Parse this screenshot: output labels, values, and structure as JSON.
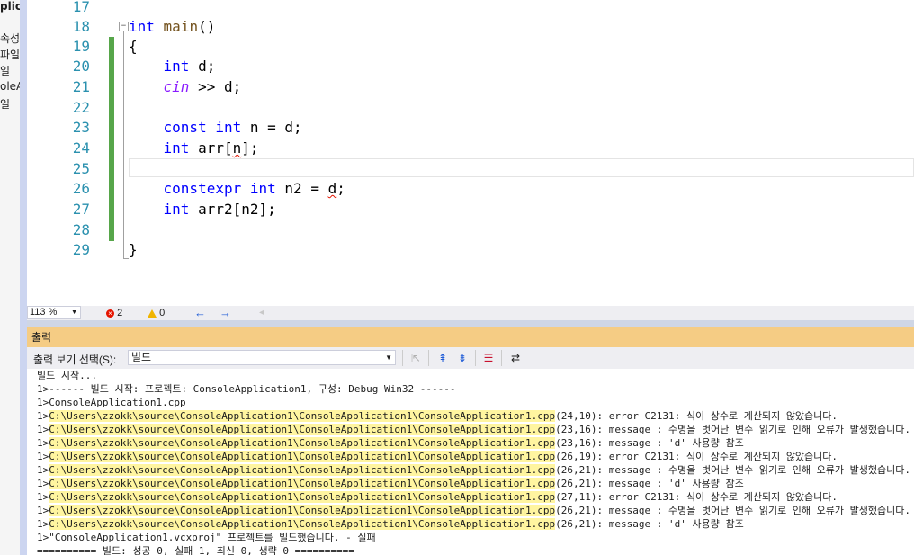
{
  "left_panel": {
    "items": [
      "plica",
      "속성",
      "파일",
      "일",
      "oleA",
      "일"
    ]
  },
  "editor": {
    "line_numbers": [
      "17",
      "18",
      "19",
      "20",
      "21",
      "22",
      "23",
      "24",
      "25",
      "26",
      "27",
      "28",
      "29"
    ],
    "outline_toggle": "−",
    "code": {
      "l18_kw": "int",
      "l18_fn": "main",
      "l18_rest": "()",
      "l19": "{",
      "l20_kw": "int",
      "l20_rest": " d;",
      "l21_it": "cin",
      "l21_rest": " >> d;",
      "l23_kw1": "const",
      "l23_kw2": "int",
      "l23_rest": " n = d;",
      "l24_kw": "int",
      "l24_pre": " arr[",
      "l24_sq": "n",
      "l24_post": "];",
      "l26_kw1": "constexpr",
      "l26_kw2": "int",
      "l26_pre": " n2 = ",
      "l26_sq": "d",
      "l26_post": ";",
      "l27_kw": "int",
      "l27_rest": " arr2[n2];",
      "l29": "}"
    }
  },
  "status_bar": {
    "zoom": "113 %",
    "errors": "2",
    "warnings": "0",
    "nav_back": "←",
    "nav_forward": "→",
    "nav_disabled": "◂"
  },
  "output": {
    "title": "출력",
    "source_label": "출력 보기 선택(S):",
    "source_value": "빌드",
    "lines": [
      {
        "pre": "빌드 시작...",
        "path": "",
        "post": ""
      },
      {
        "pre": "1>------ 빌드 시작: 프로젝트: ConsoleApplication1, 구성: Debug Win32 ------",
        "path": "",
        "post": ""
      },
      {
        "pre": "1>ConsoleApplication1.cpp",
        "path": "",
        "post": ""
      },
      {
        "pre": "1>",
        "path": "C:\\Users\\zzokk\\source\\ConsoleApplication1\\ConsoleApplication1\\ConsoleApplication1.cpp",
        "post": "(24,10): error C2131: 식이 상수로 계산되지 않았습니다."
      },
      {
        "pre": "1>",
        "path": "C:\\Users\\zzokk\\source\\ConsoleApplication1\\ConsoleApplication1\\ConsoleApplication1.cpp",
        "post": "(23,16): message : 수명을 벗어난 변수 읽기로 인해 오류가 발생했습니다."
      },
      {
        "pre": "1>",
        "path": "C:\\Users\\zzokk\\source\\ConsoleApplication1\\ConsoleApplication1\\ConsoleApplication1.cpp",
        "post": "(23,16): message : 'd' 사용량 참조"
      },
      {
        "pre": "1>",
        "path": "C:\\Users\\zzokk\\source\\ConsoleApplication1\\ConsoleApplication1\\ConsoleApplication1.cpp",
        "post": "(26,19): error C2131: 식이 상수로 계산되지 않았습니다."
      },
      {
        "pre": "1>",
        "path": "C:\\Users\\zzokk\\source\\ConsoleApplication1\\ConsoleApplication1\\ConsoleApplication1.cpp",
        "post": "(26,21): message : 수명을 벗어난 변수 읽기로 인해 오류가 발생했습니다."
      },
      {
        "pre": "1>",
        "path": "C:\\Users\\zzokk\\source\\ConsoleApplication1\\ConsoleApplication1\\ConsoleApplication1.cpp",
        "post": "(26,21): message : 'd' 사용량 참조"
      },
      {
        "pre": "1>",
        "path": "C:\\Users\\zzokk\\source\\ConsoleApplication1\\ConsoleApplication1\\ConsoleApplication1.cpp",
        "post": "(27,11): error C2131: 식이 상수로 계산되지 않았습니다."
      },
      {
        "pre": "1>",
        "path": "C:\\Users\\zzokk\\source\\ConsoleApplication1\\ConsoleApplication1\\ConsoleApplication1.cpp",
        "post": "(26,21): message : 수명을 벗어난 변수 읽기로 인해 오류가 발생했습니다."
      },
      {
        "pre": "1>",
        "path": "C:\\Users\\zzokk\\source\\ConsoleApplication1\\ConsoleApplication1\\ConsoleApplication1.cpp",
        "post": "(26,21): message : 'd' 사용량 참조"
      },
      {
        "pre": "1>\"ConsoleApplication1.vcxproj\" 프로젝트를 빌드했습니다. - 실패",
        "path": "",
        "post": ""
      },
      {
        "pre": "========== 빌드: 성공 0, 실패 1, 최신 0, 생략 0 ==========",
        "path": "",
        "post": ""
      }
    ]
  },
  "colors": {
    "keyword": "#0000ff",
    "function": "#74531f",
    "line_number": "#2b91af",
    "change_bar": "#57a64a",
    "output_title_bg": "#f5cc84",
    "path_highlight": "#fff5a0",
    "error": "#e51400",
    "warning": "#f0b400"
  },
  "icons": [
    "error-circle-icon",
    "warning-triangle-icon",
    "arrow-back-icon",
    "arrow-forward-icon",
    "go-to-source-icon",
    "prev-message-icon",
    "next-message-icon",
    "clear-all-icon",
    "word-wrap-icon"
  ]
}
